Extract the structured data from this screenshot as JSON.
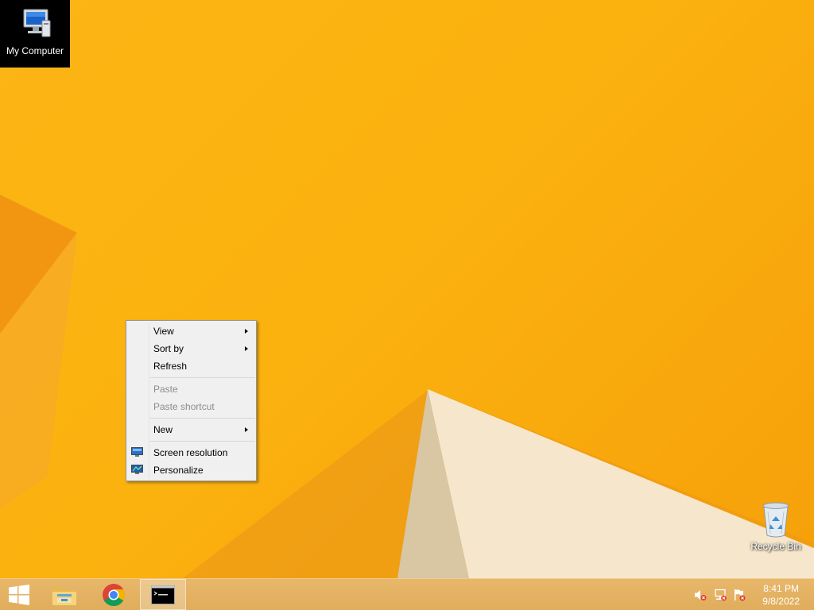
{
  "desktop": {
    "icons": [
      {
        "label": "My Computer"
      },
      {
        "label": "Recycle Bin"
      }
    ]
  },
  "context_menu": {
    "items": [
      {
        "label": "View",
        "submenu": true,
        "enabled": true
      },
      {
        "label": "Sort by",
        "submenu": true,
        "enabled": true
      },
      {
        "label": "Refresh",
        "submenu": false,
        "enabled": true
      },
      {
        "label": "Paste",
        "submenu": false,
        "enabled": false
      },
      {
        "label": "Paste shortcut",
        "submenu": false,
        "enabled": false
      },
      {
        "label": "New",
        "submenu": true,
        "enabled": true
      },
      {
        "label": "Screen resolution",
        "submenu": false,
        "enabled": true,
        "icon": "monitor-icon"
      },
      {
        "label": "Personalize",
        "submenu": false,
        "enabled": true,
        "icon": "personalize-icon"
      }
    ]
  },
  "taskbar": {
    "pinned": [
      {
        "icon": "windows-logo-icon"
      },
      {
        "icon": "file-explorer-icon"
      },
      {
        "icon": "chrome-icon"
      },
      {
        "icon": "command-prompt-icon",
        "active": true
      }
    ],
    "tray": [
      {
        "icon": "speaker-muted-icon"
      },
      {
        "icon": "network-error-icon"
      },
      {
        "icon": "action-center-flag-icon"
      }
    ],
    "clock": {
      "time": "8:41 PM",
      "date": "9/8/2022"
    }
  },
  "colors": {
    "wallpaper": "#fbb514",
    "taskbar": "#e0ad5c",
    "menu_background": "#f0f0f0",
    "disabled_text": "#8d8d8d"
  }
}
